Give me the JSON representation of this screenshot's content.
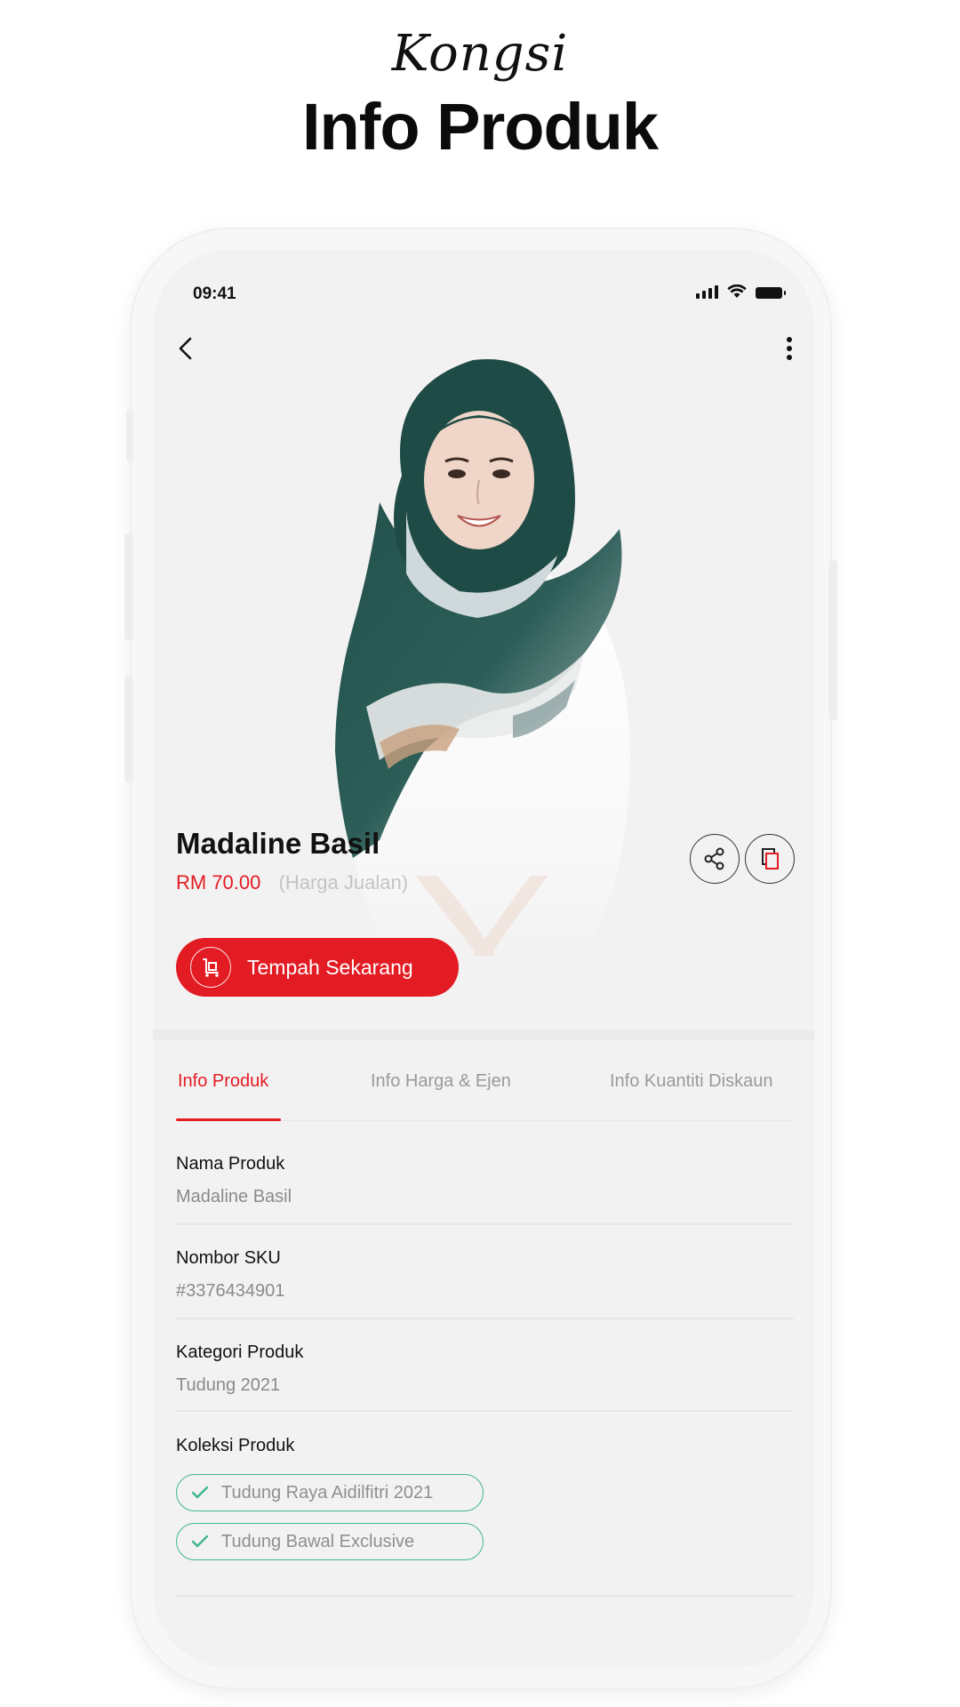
{
  "header": {
    "script_title": "Kongsi",
    "title": "Info Produk"
  },
  "status_bar": {
    "time": "09:41",
    "icons": [
      "signal-icon",
      "wifi-icon",
      "battery-icon"
    ]
  },
  "product": {
    "name": "Madaline Basil",
    "price": "RM 70.00",
    "price_note": "(Harga Jualan)",
    "order_button": "Tempah Sekarang"
  },
  "tabs": [
    {
      "label": "Info Produk",
      "active": true
    },
    {
      "label": "Info Harga & Ejen",
      "active": false
    },
    {
      "label": "Info Kuantiti Diskaun",
      "active": false
    }
  ],
  "details": {
    "name_label": "Nama Produk",
    "name_value": "Madaline Basil",
    "sku_label": "Nombor SKU",
    "sku_value": "#3376434901",
    "category_label": "Kategori Produk",
    "category_value": "Tudung 2021",
    "collection_label": "Koleksi Produk",
    "collections": [
      "Tudung Raya Aidilfitri 2021",
      "Tudung Bawal Exclusive"
    ]
  },
  "colors": {
    "accent": "#e31b23",
    "check": "#3fb78a",
    "scarf": "#1f4b47"
  }
}
